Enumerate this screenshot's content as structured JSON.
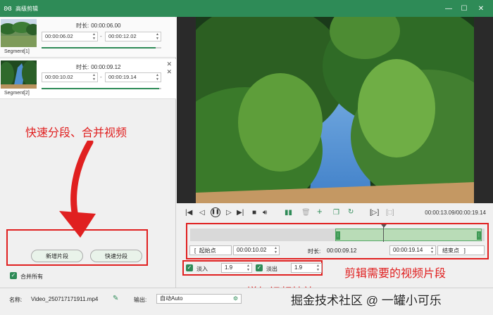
{
  "window": {
    "title": "高级剪辑",
    "app_icon": "rabbit-logo-icon",
    "minimize": "—",
    "maximize": "☐",
    "close": "✕"
  },
  "segments": [
    {
      "label": "Segment[1]",
      "duration_label": "时长:",
      "duration": "00:00:06.00",
      "start": "00:00:06.02",
      "end": "00:00:12.02",
      "progress": 0.95
    },
    {
      "label": "Segment[2]",
      "duration_label": "时长:",
      "duration": "00:00:09.12",
      "start": "00:00:10.02",
      "end": "00:00:19.14",
      "progress": 0.98,
      "close_glyph": "✕",
      "marker_glyph": "✕"
    }
  ],
  "left_actions": {
    "add_segment": "新增片段",
    "quick_split": "快速分段",
    "merge_all": "合并所有",
    "merge_all_checked": true
  },
  "annotations": {
    "split_merge": "快速分段、合并视频",
    "trim": "剪辑需要的视频片段",
    "effects": "增加视频特效"
  },
  "player": {
    "timecode": "00:00:13.09/00:00:19.14",
    "icons": [
      "go-start-icon",
      "prev-frame-icon",
      "pause-icon",
      "next-frame-icon",
      "go-end-icon",
      "stop-icon",
      "volume-icon",
      "split-icon",
      "delete-icon",
      "add-icon",
      "copy-icon",
      "refresh-icon",
      "mark-in-icon",
      "mark-out-icon"
    ]
  },
  "timeline": {
    "selection_start_fraction": 0.49,
    "selection_end_fraction": 0.99,
    "playhead_fraction": 0.66
  },
  "range": {
    "open_bracket": "[",
    "start_point_label": "起始点",
    "start_value": "00:00:10.02",
    "duration_label": "时长:",
    "duration_value": "00:00:09.12",
    "end_value": "00:00:19.14",
    "end_point_label": "结束点",
    "close_bracket": "]"
  },
  "effects": {
    "fade_in_label": "淡入",
    "fade_in_value": "1.9",
    "fade_out_label": "淡出",
    "fade_out_value": "1.9",
    "fade_in_checked": true,
    "fade_out_checked": true
  },
  "bottom": {
    "name_label": "名称:",
    "file_name": "Video_250717171911.mp4",
    "output_label": "输出:",
    "output_value": "自动Auto"
  },
  "watermark": "掘金技术社区 @ 一罐小可乐",
  "colors": {
    "accent": "#2e8b57",
    "highlight": "#e02020",
    "selection": "#b9dcb7"
  }
}
